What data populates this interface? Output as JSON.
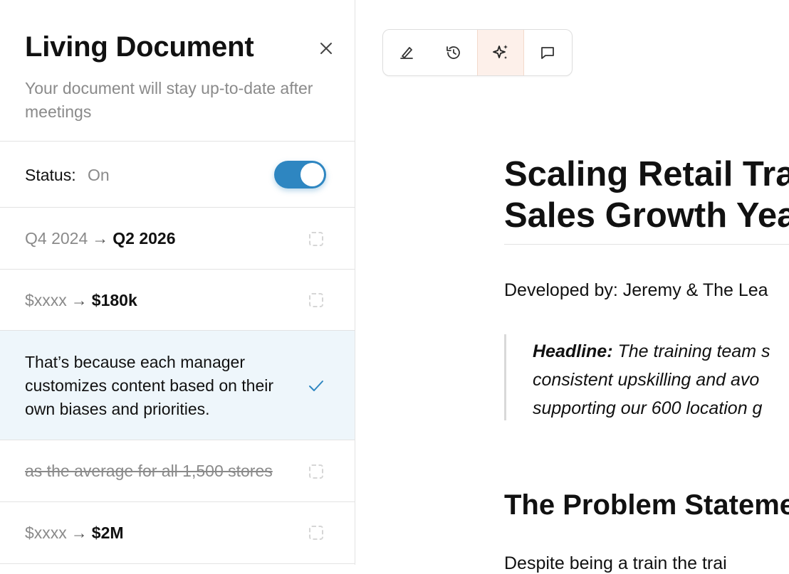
{
  "sidebar": {
    "title": "Living Document",
    "subtitle": "Your document will stay up-to-date after meetings",
    "status_label": "Status:",
    "status_value": "On",
    "changes": [
      {
        "old": "Q4 2024",
        "arrow": "→",
        "new": "Q2 2026",
        "state": "unchecked"
      },
      {
        "old": "$xxxx",
        "arrow": "→",
        "new": "$180k",
        "state": "unchecked"
      },
      {
        "text": "That’s because each manager customizes content based on their own biases and priorities.",
        "state": "checked"
      },
      {
        "removed": "as the average for all 1,500 stores",
        "state": "unchecked"
      },
      {
        "old": "$xxxx",
        "arrow": "→",
        "new": "$2M",
        "state": "unchecked"
      }
    ]
  },
  "toolbar": {
    "buttons": [
      {
        "icon": "highlighter-icon"
      },
      {
        "icon": "history-icon"
      },
      {
        "icon": "sparkles-icon",
        "active": true
      },
      {
        "icon": "comment-icon"
      }
    ]
  },
  "document": {
    "title_line1": "Scaling Retail Tra",
    "title_line2": "Sales Growth Yea",
    "developed_by": "Developed by: Jeremy & The Lea",
    "headline_label": "Headline:",
    "headline_line1": " The training team s",
    "headline_line2": "consistent upskilling and avo",
    "headline_line3": "supporting our 600 location g",
    "section_heading": "The Problem Stateme",
    "paragraph_start": "Despite being a train the trai"
  },
  "colors": {
    "accent": "#2e86c1",
    "selected_row": "#eef6fb",
    "active_tool": "#fdf0ea"
  }
}
